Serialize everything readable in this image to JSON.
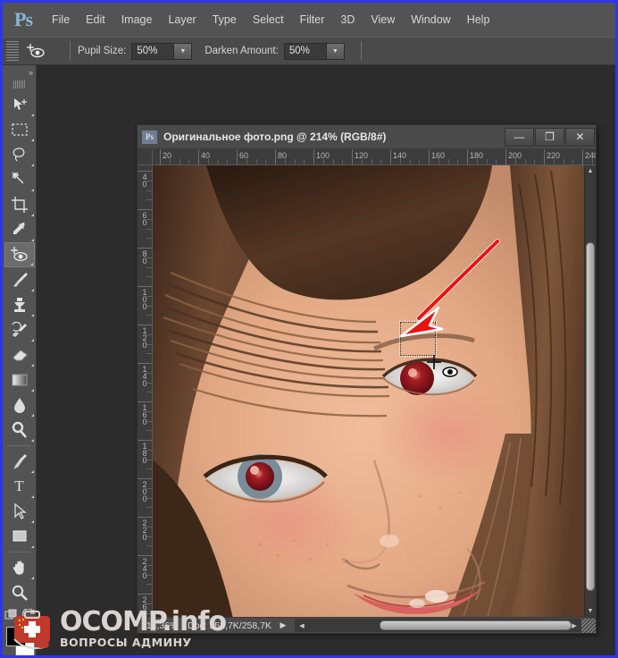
{
  "app": {
    "name": "Adobe Photoshop",
    "logo_text": "Ps",
    "accent_color": "#8cb4d8",
    "window_border_color": "#2d36e8"
  },
  "menubar": {
    "items": [
      {
        "label": "File"
      },
      {
        "label": "Edit"
      },
      {
        "label": "Image"
      },
      {
        "label": "Layer"
      },
      {
        "label": "Type"
      },
      {
        "label": "Select"
      },
      {
        "label": "Filter"
      },
      {
        "label": "3D"
      },
      {
        "label": "View"
      },
      {
        "label": "Window"
      },
      {
        "label": "Help"
      }
    ]
  },
  "options_bar": {
    "tool_icon": "red-eye-tool-icon",
    "tool_preset_arrow": "chevron-down-icon",
    "pupil_size": {
      "label": "Pupil Size:",
      "value": "50%"
    },
    "darken_amount": {
      "label": "Darken Amount:",
      "value": "50%"
    }
  },
  "toolbar": {
    "collapse_label": "»",
    "tools": [
      {
        "name": "move-tool",
        "icon": "move-icon",
        "active": false
      },
      {
        "name": "rectangular-marquee-tool",
        "icon": "marquee-icon",
        "active": false
      },
      {
        "name": "lasso-tool",
        "icon": "lasso-icon",
        "active": false
      },
      {
        "name": "magic-wand-tool",
        "icon": "magic-wand-icon",
        "active": false
      },
      {
        "name": "crop-tool",
        "icon": "crop-icon",
        "active": false
      },
      {
        "name": "eyedropper-tool",
        "icon": "eyedropper-icon",
        "active": false
      },
      {
        "name": "red-eye-tool",
        "icon": "red-eye-icon",
        "active": true
      },
      {
        "name": "brush-tool",
        "icon": "brush-icon",
        "active": false
      },
      {
        "name": "clone-stamp-tool",
        "icon": "clone-stamp-icon",
        "active": false
      },
      {
        "name": "history-brush-tool",
        "icon": "history-brush-icon",
        "active": false
      },
      {
        "name": "eraser-tool",
        "icon": "eraser-icon",
        "active": false
      },
      {
        "name": "gradient-tool",
        "icon": "gradient-icon",
        "active": false
      },
      {
        "name": "blur-tool",
        "icon": "blur-droplet-icon",
        "active": false
      },
      {
        "name": "dodge-tool",
        "icon": "dodge-icon",
        "active": false
      },
      {
        "name": "pen-tool",
        "icon": "pen-icon",
        "active": false
      },
      {
        "name": "type-tool",
        "icon": "type-T-icon",
        "active": false
      },
      {
        "name": "path-selection-tool",
        "icon": "path-arrow-icon",
        "active": false
      },
      {
        "name": "shape-tool",
        "icon": "rectangle-shape-icon",
        "active": false
      },
      {
        "name": "hand-tool",
        "icon": "hand-icon",
        "active": false
      },
      {
        "name": "zoom-tool",
        "icon": "magnifier-icon",
        "active": false
      }
    ],
    "quick_mask_icon": "quick-mask-icon",
    "screen-mode-icon": "screen-mode-icon",
    "foreground_color": "#000000",
    "background_color": "#ffffff"
  },
  "document": {
    "title": "Оригинальное фото.png @ 214% (RGB/8#)",
    "filename": "Оригинальное фото.png",
    "zoom": "214%",
    "color_mode": "RGB/8#",
    "icon_text": "Ps",
    "window_buttons": {
      "minimize": "—",
      "restore": "❐",
      "close": "✕"
    },
    "ruler_h_labels": [
      "20",
      "40",
      "60",
      "80",
      "100",
      "120",
      "140",
      "160",
      "180",
      "200",
      "220",
      "240"
    ],
    "ruler_v_labels": [
      "40",
      "60",
      "80",
      "100",
      "120",
      "140",
      "160",
      "180",
      "200",
      "220",
      "240",
      "260"
    ],
    "status": {
      "zoom_value": "214,36%",
      "doc_label": "Doc: 258,7K/258,7K",
      "play_icon": "play-triangle-icon",
      "left_arrow_icon": "scroll-left-icon",
      "right_arrow_icon": "scroll-right-icon",
      "resize_grip_icon": "resize-grip-icon"
    },
    "scrollbars": {
      "vertical_up_icon": "scroll-up-icon",
      "vertical_down_icon": "scroll-down-icon"
    }
  },
  "annotation": {
    "arrow_color": "#ee1111",
    "arrow_name": "red-pointer-arrow",
    "target": "red-eye-pupil",
    "selection_marquee": "dotted-selection-rectangle",
    "cursor": "red-eye-tool-cursor"
  },
  "photo": {
    "subject": "girl face close-up with red-eye effect",
    "alt": "Оригинальное фото",
    "skin_color": "#e0aa8a",
    "hair_color": "#4a3123",
    "red_eye_color": "#8b1018"
  },
  "watermark": {
    "main": "OCOMP.info",
    "sub": "ВОПРОСЫ АДМИНУ",
    "logo": "first-aid-kit-icon",
    "logo_color": "#c0392b"
  }
}
